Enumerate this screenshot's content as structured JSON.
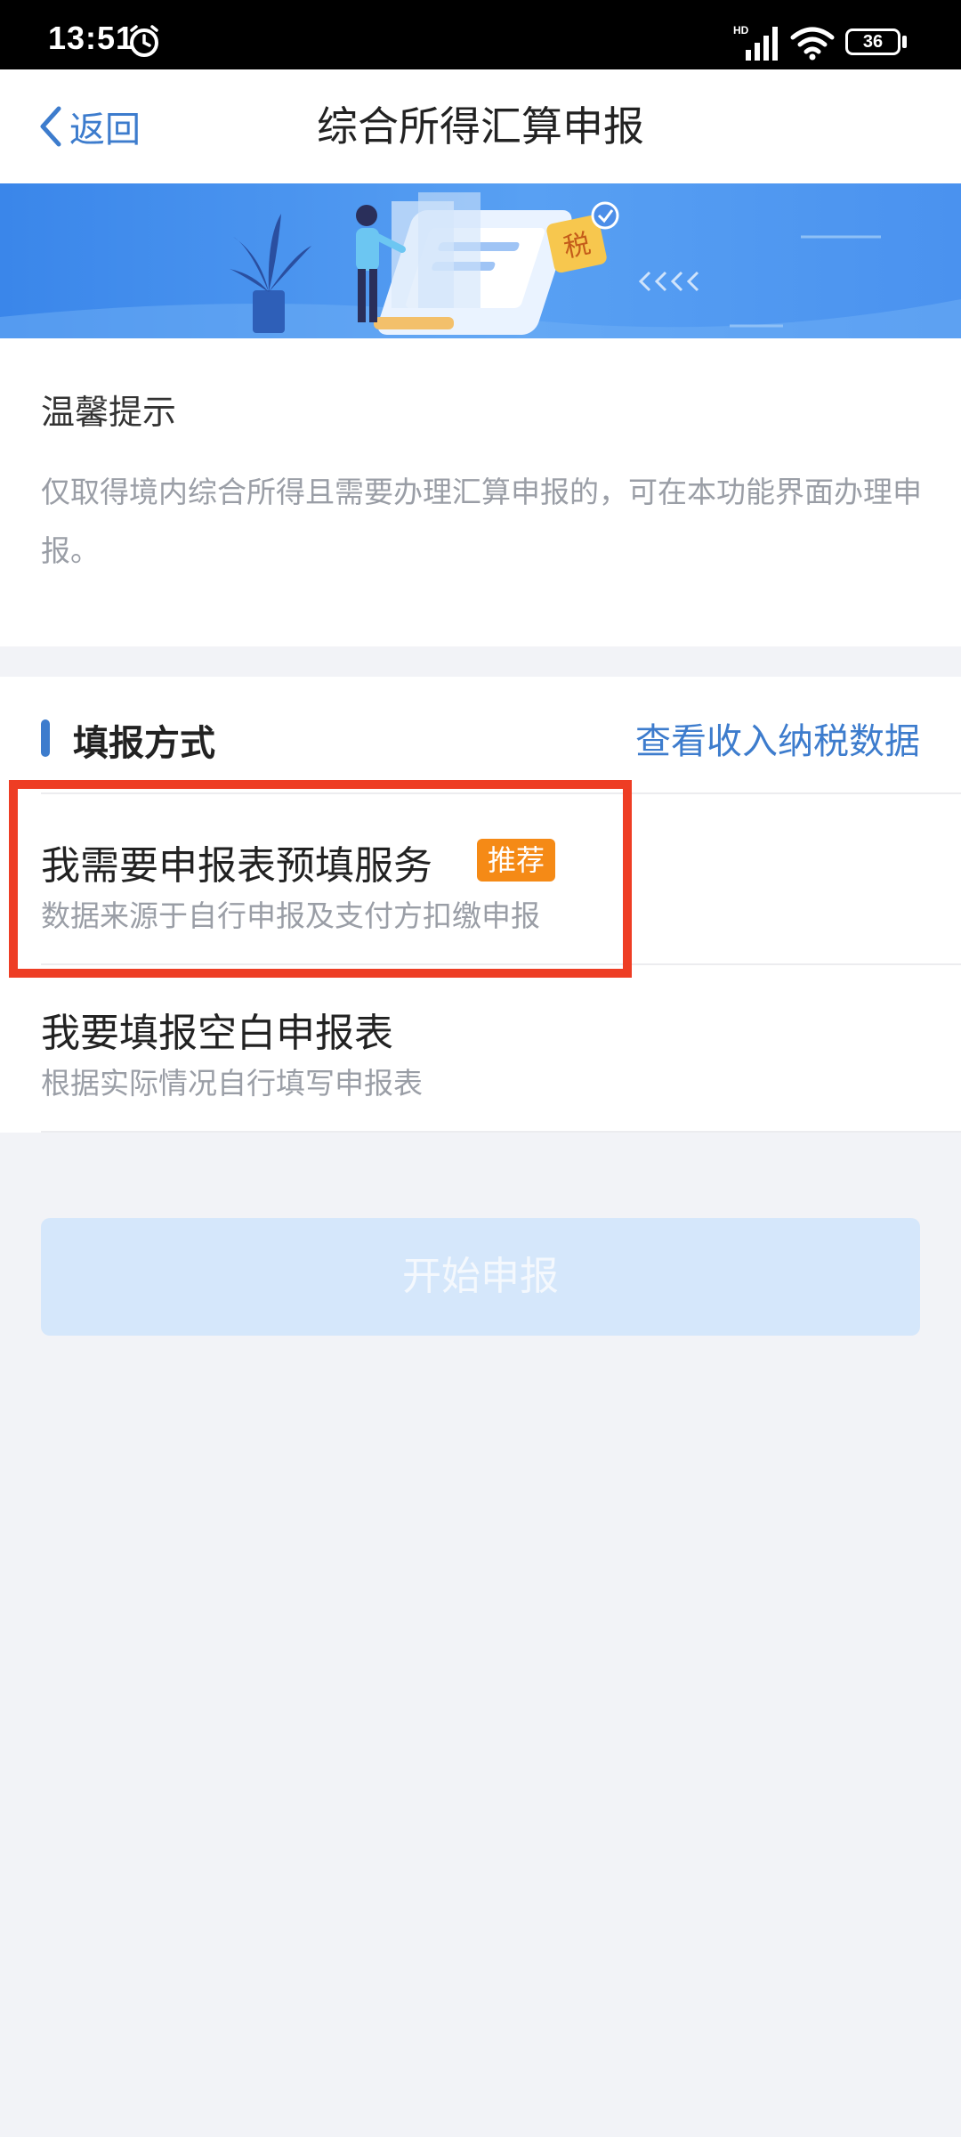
{
  "status_bar": {
    "time": "13:51",
    "network": "HD",
    "battery": "36"
  },
  "nav": {
    "back_label": "返回",
    "title": "综合所得汇算申报"
  },
  "banner": {
    "tax_badge": "税"
  },
  "tips": {
    "title": "温馨提示",
    "body": "仅取得境内综合所得且需要办理汇算申报的，可在本功能界面办理申报。"
  },
  "method": {
    "title": "填报方式",
    "link": "查看收入纳税数据",
    "options": [
      {
        "title": "我需要申报表预填服务",
        "badge": "推荐",
        "subtitle": "数据来源于自行申报及支付方扣缴申报"
      },
      {
        "title": "我要填报空白申报表",
        "subtitle": "根据实际情况自行填写申报表"
      }
    ]
  },
  "start_button": "开始申报",
  "colors": {
    "accent": "#3d7ccd",
    "badge": "#f58a16",
    "highlight": "#ee3d24",
    "disabled_button": "#d5e7fb"
  }
}
